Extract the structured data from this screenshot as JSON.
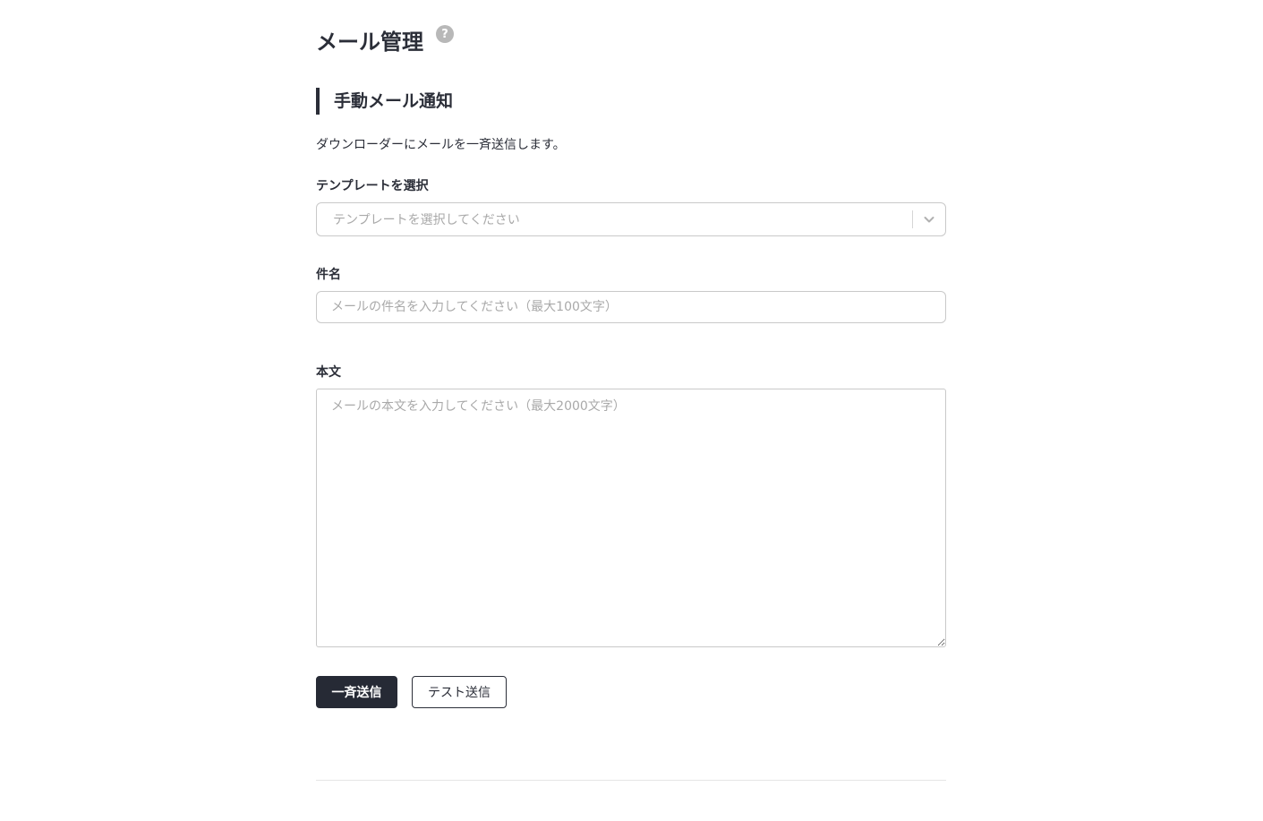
{
  "page": {
    "title": "メール管理",
    "help_icon": "?"
  },
  "section": {
    "title": "手動メール通知",
    "description": "ダウンローダーにメールを一斉送信します。"
  },
  "template_field": {
    "label": "テンプレートを選択",
    "placeholder": "テンプレートを選択してください",
    "arrow_icon": "chevron-down-icon"
  },
  "subject_field": {
    "label": "件名",
    "placeholder": "メールの件名を入力してください（最大100文字）",
    "value": ""
  },
  "body_field": {
    "label": "本文",
    "placeholder": "メールの本文を入力してください（最大2000文字）",
    "value": ""
  },
  "actions": {
    "send_all_label": "一斉送信",
    "test_send_label": "テスト送信"
  },
  "colors": {
    "primary": "#262a35",
    "border": "#c9c9c9",
    "placeholder": "#a9a9a9",
    "help_icon_bg": "#b8b8b8"
  }
}
